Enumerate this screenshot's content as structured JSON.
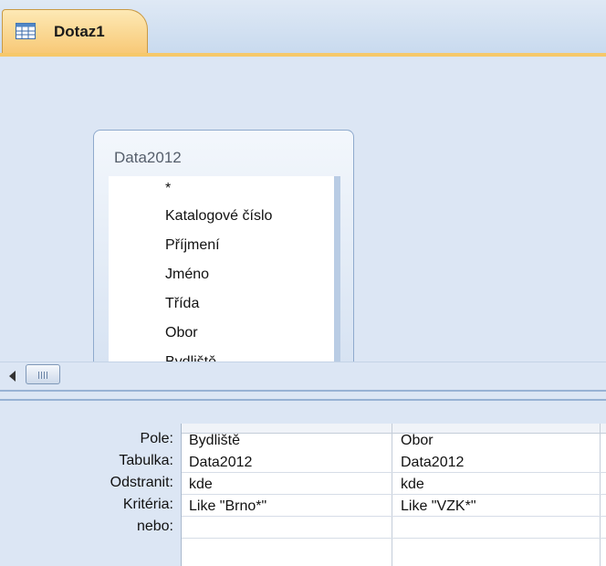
{
  "tab": {
    "label": "Dotaz1",
    "icon": "query-icon"
  },
  "table_box": {
    "title": "Data2012",
    "fields": [
      "*",
      "Katalogové číslo",
      "Příjmení",
      "Jméno",
      "Třída",
      "Obor",
      "Bydliště"
    ]
  },
  "grid": {
    "row_labels": {
      "field": "Pole:",
      "table": "Tabulka:",
      "sort": "Odstranit:",
      "criteria": "Kritéria:",
      "or": "nebo:"
    },
    "columns": [
      {
        "field": "Bydliště",
        "table": "Data2012",
        "sort": "kde",
        "criteria": "Like \"Brno*\"",
        "or": ""
      },
      {
        "field": "Obor",
        "table": "Data2012",
        "sort": "kde",
        "criteria": "Like \"VZK*\"",
        "or": ""
      }
    ]
  },
  "colors": {
    "tab_accent": "#f8c977",
    "design_background": "#dce6f4"
  }
}
